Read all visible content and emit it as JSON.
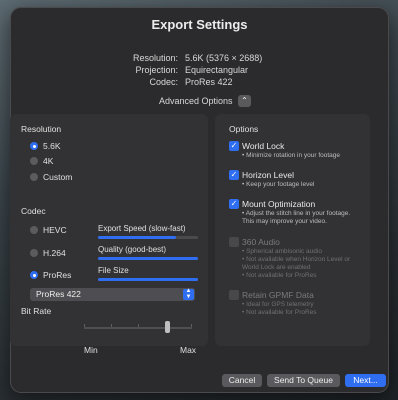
{
  "dialog": {
    "title": "Export Settings",
    "summary": [
      {
        "label": "Resolution:",
        "value": "5.6K (5376 × 2688)"
      },
      {
        "label": "Projection:",
        "value": "Equirectangular"
      },
      {
        "label": "Codec:",
        "value": "ProRes 422"
      }
    ],
    "advanced_label": "Advanced Options",
    "advanced_icon": "chevron-up-icon"
  },
  "resolution": {
    "heading": "Resolution",
    "options": [
      {
        "label": "5.6K",
        "selected": true
      },
      {
        "label": "4K",
        "selected": false
      },
      {
        "label": "Custom",
        "selected": false
      }
    ]
  },
  "codec": {
    "heading": "Codec",
    "options": [
      {
        "label": "HEVC",
        "selected": false
      },
      {
        "label": "H.264",
        "selected": false
      },
      {
        "label": "ProRes",
        "selected": true
      }
    ],
    "bars": [
      {
        "label": "Export Speed (slow-fast)",
        "fill": 0.78
      },
      {
        "label": "Quality (good-best)",
        "fill": 1.0
      },
      {
        "label": "File Size",
        "fill": 1.0
      }
    ],
    "select_value": "ProRes 422"
  },
  "bitrate": {
    "heading": "Bit Rate",
    "min_label": "Min",
    "max_label": "Max",
    "level": 0.8
  },
  "options": {
    "heading": "Options",
    "items": [
      {
        "title": "World Lock",
        "checked": true,
        "enabled": true,
        "desc": [
          "• Minimize rotation in your footage"
        ]
      },
      {
        "title": "Horizon Level",
        "checked": true,
        "enabled": true,
        "desc": [
          "• Keep your footage level"
        ]
      },
      {
        "title": "Mount Optimization",
        "checked": true,
        "enabled": true,
        "desc": [
          "• Adjust the stitch line in your footage.",
          "  This may improve your video."
        ]
      },
      {
        "title": "360 Audio",
        "checked": false,
        "enabled": false,
        "desc": [
          "• Spherical ambisonic audio",
          "• Not available when Horizon Level or",
          "  World Lock are enabled",
          "• Not available for ProRes"
        ]
      },
      {
        "title": "Retain GPMF Data",
        "checked": false,
        "enabled": false,
        "desc": [
          "• Ideal for GPS telemetry",
          "• Not available for ProRes"
        ]
      }
    ]
  },
  "footer": {
    "cancel": "Cancel",
    "queue": "Send To Queue",
    "next": "Next..."
  },
  "colors": {
    "accent": "#2f6ef0",
    "dialog_bg": "#2b2b2d",
    "panel_bg": "#323234"
  }
}
